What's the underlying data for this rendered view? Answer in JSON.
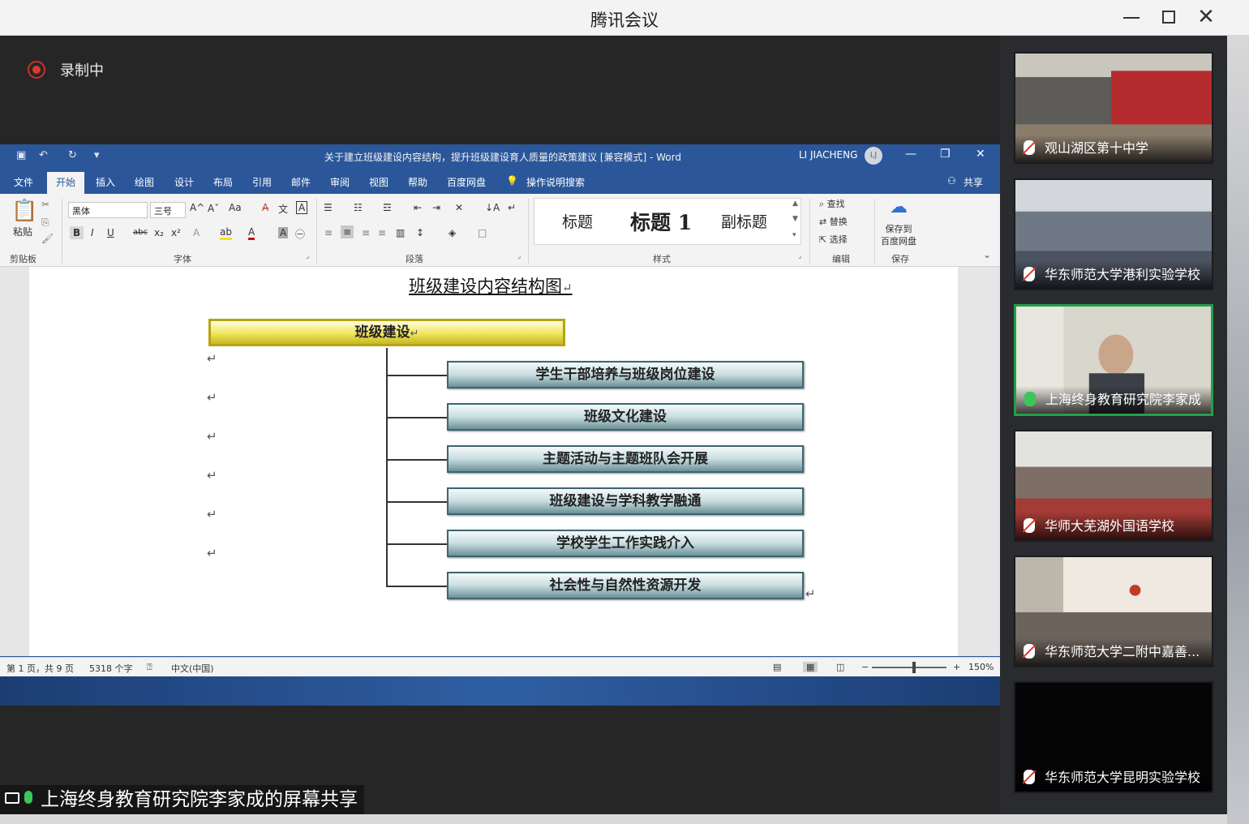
{
  "window": {
    "title": "腾讯会议"
  },
  "recording": {
    "label": "录制中"
  },
  "word": {
    "doc_title": "关于建立班级建设内容结构，提升班级建设育人质量的政策建议 [兼容模式] - Word",
    "user": "LI JIACHENG",
    "user_initial": "LJ",
    "tabs": [
      "文件",
      "开始",
      "插入",
      "绘图",
      "设计",
      "布局",
      "引用",
      "邮件",
      "审阅",
      "视图",
      "帮助",
      "百度网盘"
    ],
    "tell_me": "操作说明搜索",
    "share": "共享",
    "ribbon": {
      "paste": "粘贴",
      "clipboard": "剪贴板",
      "font_name": "黑体",
      "font_size": "三号",
      "font_group": "字体",
      "paragraph_group": "段落",
      "styles_group": "样式",
      "styles": [
        "标题",
        "标题 1",
        "副标题"
      ],
      "find": "查找",
      "replace": "替换",
      "select": "选择",
      "editing_group": "编辑",
      "save_baidu": "保存到\n百度网盘",
      "save_group": "保存"
    },
    "document": {
      "heading": "班级建设内容结构图",
      "root": "班级建设",
      "children": [
        "学生干部培养与班级岗位建设",
        "班级文化建设",
        "主题活动与主题班队会开展",
        "班级建设与学科教学融通",
        "学校学生工作实践介入",
        "社会性与自然性资源开发"
      ]
    },
    "status": {
      "page": "第 1 页，共 9 页",
      "words": "5318 个字",
      "language": "中文(中国)",
      "zoom": "150%"
    }
  },
  "sharer_label": "上海终身教育研究院李家成的屏幕共享",
  "participants": [
    {
      "name": "观山湖区第十中学",
      "mic": "muted"
    },
    {
      "name": "华东师范大学港利实验学校",
      "mic": "muted"
    },
    {
      "name": "上海终身教育研究院李家成",
      "mic": "on",
      "active": true
    },
    {
      "name": "华师大芜湖外国语学校",
      "mic": "muted"
    },
    {
      "name": "华东师范大学二附中嘉善...",
      "mic": "muted"
    },
    {
      "name": "华东师范大学昆明实验学校",
      "mic": "muted"
    }
  ],
  "colors": {
    "word_blue": "#2b579a",
    "active_speaker": "#21a04b",
    "recording": "#d93a2e"
  }
}
